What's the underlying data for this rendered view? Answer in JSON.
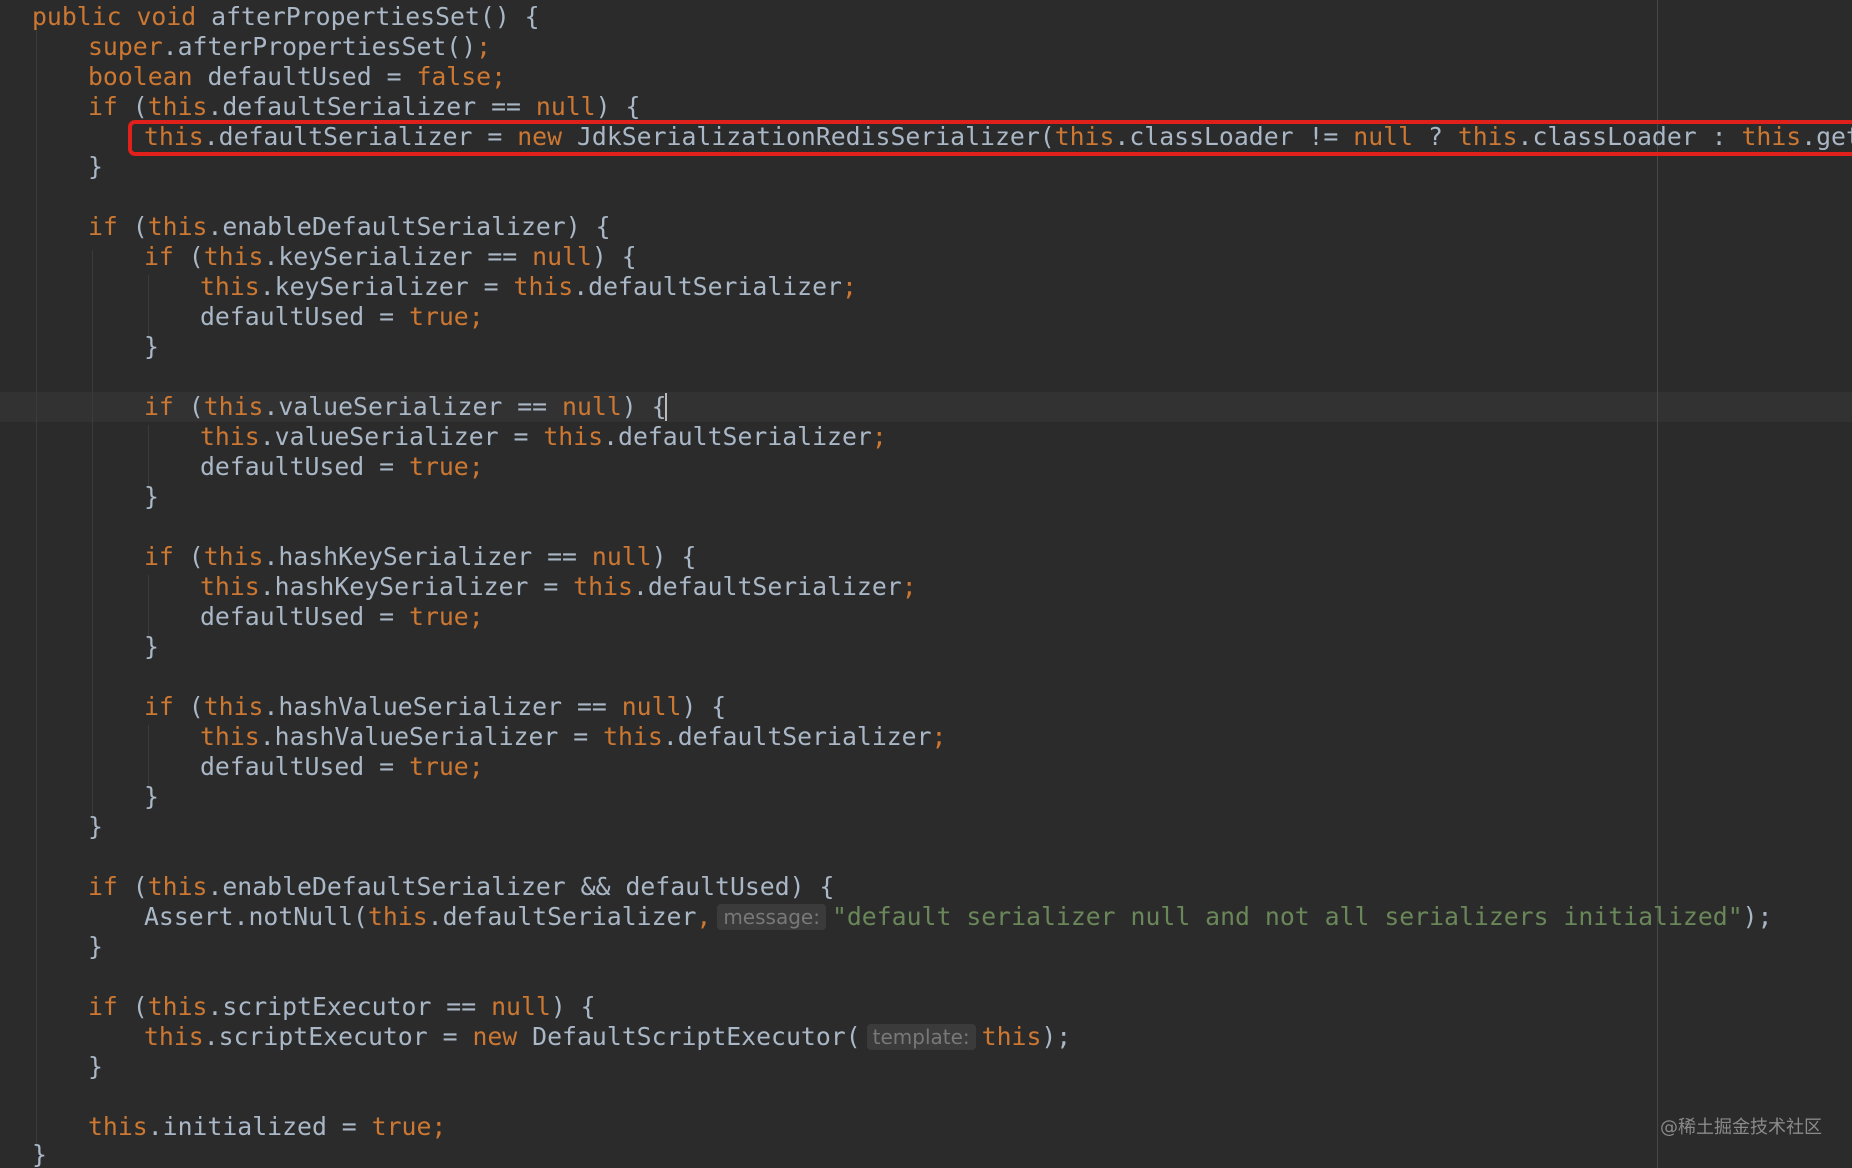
{
  "editor": {
    "language": "java",
    "theme_colors": {
      "background": "#2b2b2b",
      "keyword": "#cc7832",
      "string": "#6a8759",
      "plain": "#a9b7c6",
      "hint_background": "#3b3b3b",
      "highlight_border": "#e0201b"
    },
    "code": {
      "l1": {
        "a": "public void",
        "b": " afterPropertiesSet() {"
      },
      "l2": {
        "a": "super",
        "b": ".afterPropertiesSet()",
        "c": ";"
      },
      "l3": {
        "a": "boolean",
        "b": " defaultUsed = ",
        "c": "false;"
      },
      "l4": {
        "a": "if",
        "b": " (",
        "c": "this",
        "d": ".defaultSerializer == ",
        "e": "null",
        "f": ") {"
      },
      "l5": {
        "a": "this",
        "b": ".defaultSerializer = ",
        "c": "new",
        "d": " JdkSerializationRedisSerializer(",
        "e": "this",
        "f": ".classLoader != ",
        "g": "null",
        "h": " ? ",
        "i": "this",
        "j": ".classLoader : ",
        "k": "this",
        "l": ".getClass()"
      },
      "l6": {
        "a": "}"
      },
      "l7": {
        "a": "if",
        "b": " (",
        "c": "this",
        "d": ".enableDefaultSerializer) {"
      },
      "l8": {
        "a": "if",
        "b": " (",
        "c": "this",
        "d": ".keySerializer == ",
        "e": "null",
        "f": ") {"
      },
      "l9": {
        "a": "this",
        "b": ".keySerializer = ",
        "c": "this",
        "d": ".defaultSerializer",
        "e": ";"
      },
      "l10": {
        "a": "defaultUsed = ",
        "b": "true;"
      },
      "l11": {
        "a": "}"
      },
      "l12": {
        "a": "if",
        "b": " (",
        "c": "this",
        "d": ".valueSerializer == ",
        "e": "null",
        "f": ") {"
      },
      "l13": {
        "a": "this",
        "b": ".valueSerializer = ",
        "c": "this",
        "d": ".defaultSerializer",
        "e": ";"
      },
      "l14": {
        "a": "defaultUsed = ",
        "b": "true;"
      },
      "l15": {
        "a": "}"
      },
      "l16": {
        "a": "if",
        "b": " (",
        "c": "this",
        "d": ".hashKeySerializer == ",
        "e": "null",
        "f": ") {"
      },
      "l17": {
        "a": "this",
        "b": ".hashKeySerializer = ",
        "c": "this",
        "d": ".defaultSerializer",
        "e": ";"
      },
      "l18": {
        "a": "defaultUsed = ",
        "b": "true;"
      },
      "l19": {
        "a": "}"
      },
      "l20": {
        "a": "if",
        "b": " (",
        "c": "this",
        "d": ".hashValueSerializer == ",
        "e": "null",
        "f": ") {"
      },
      "l21": {
        "a": "this",
        "b": ".hashValueSerializer = ",
        "c": "this",
        "d": ".defaultSerializer",
        "e": ";"
      },
      "l22": {
        "a": "defaultUsed = ",
        "b": "true;"
      },
      "l23": {
        "a": "}"
      },
      "l24": {
        "a": "}"
      },
      "l25": {
        "a": "if",
        "b": " (",
        "c": "this",
        "d": ".enableDefaultSerializer && defaultUsed) {"
      },
      "l26": {
        "a": "Assert.notNull(",
        "b": "this",
        "c": ".defaultSerializer",
        "d": ",",
        "hint": "message:",
        "e": "\"default serializer null and not all serializers initialized\"",
        "f": ");"
      },
      "l27": {
        "a": "}"
      },
      "l28": {
        "a": "if",
        "b": " (",
        "c": "this",
        "d": ".scriptExecutor == ",
        "e": "null",
        "f": ") {"
      },
      "l29": {
        "a": "this",
        "b": ".scriptExecutor = ",
        "c": "new",
        "d": " DefaultScriptExecutor(",
        "hint": "template:",
        "e": "this",
        "f": ");"
      },
      "l30": {
        "a": "}"
      },
      "l31": {
        "a": "this",
        "b": ".initialized = ",
        "c": "true;"
      },
      "l32": {
        "a": "}"
      }
    }
  },
  "watermark": {
    "text": "@稀土掘金技术社区"
  }
}
